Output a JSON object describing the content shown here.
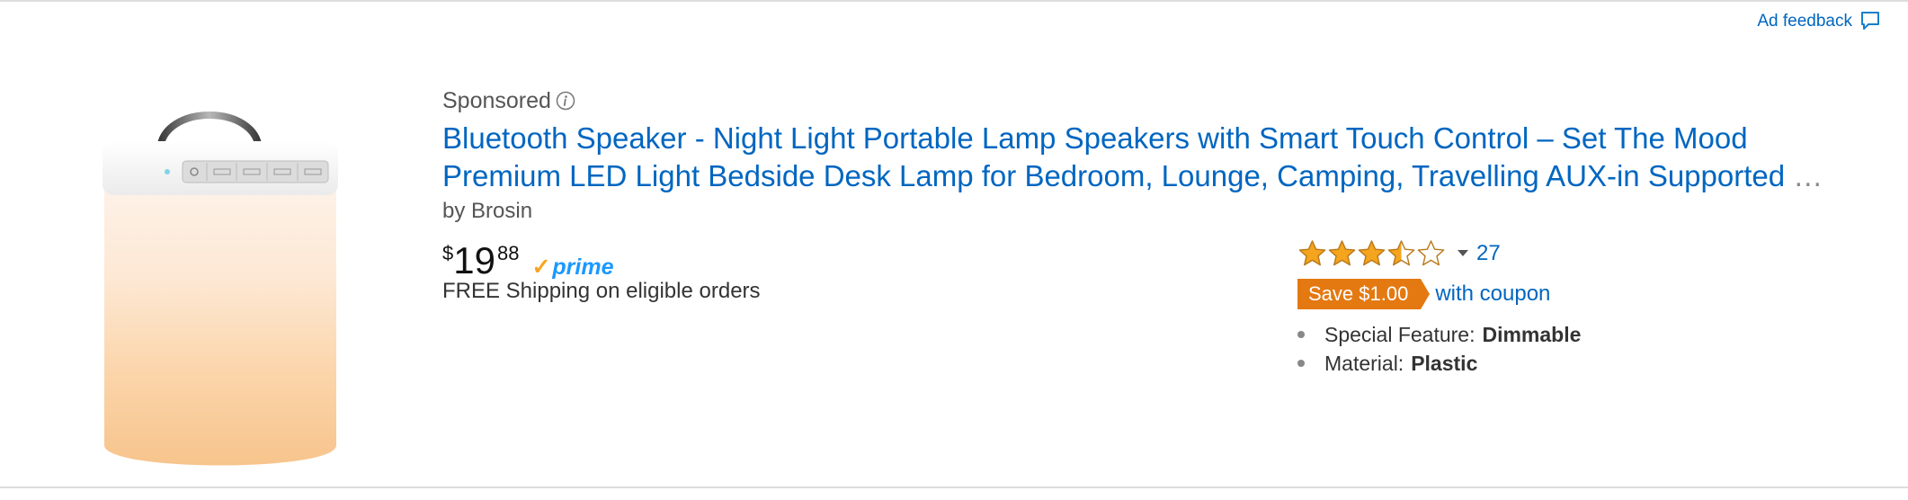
{
  "ad_feedback": {
    "label": "Ad feedback",
    "icon": "speech-bubble-icon"
  },
  "product": {
    "sponsored_label": "Sponsored",
    "info_icon": "info-icon",
    "title_line1": "Bluetooth Speaker - Night Light Portable Lamp Speakers with Smart Touch Control – Set The Mood",
    "title_line2": "Premium LED Light Bedside Desk Lamp for Bedroom, Lounge, Camping, Travelling AUX-in Supported",
    "title_ellipsis": "…",
    "byline_prefix": "by",
    "brand": "Brosin",
    "image_alt_icon": "lamp-speaker-image",
    "price": {
      "symbol": "$",
      "whole": "19",
      "fraction": "88"
    },
    "prime_label": "prime",
    "shipping": "FREE Shipping on eligible orders",
    "rating": {
      "stars_out_of_5": 3.5,
      "count": "27"
    },
    "coupon": {
      "badge": "Save $1.00",
      "link": "with coupon"
    },
    "features": [
      {
        "label": "Special Feature:",
        "value": "Dimmable"
      },
      {
        "label": "Material:",
        "value": "Plastic"
      }
    ]
  },
  "colors": {
    "link": "#0066c0",
    "coupon": "#e47911",
    "star": "#f4a41d",
    "prime_blue": "#1a98ff",
    "prime_check": "#f7a41d"
  }
}
